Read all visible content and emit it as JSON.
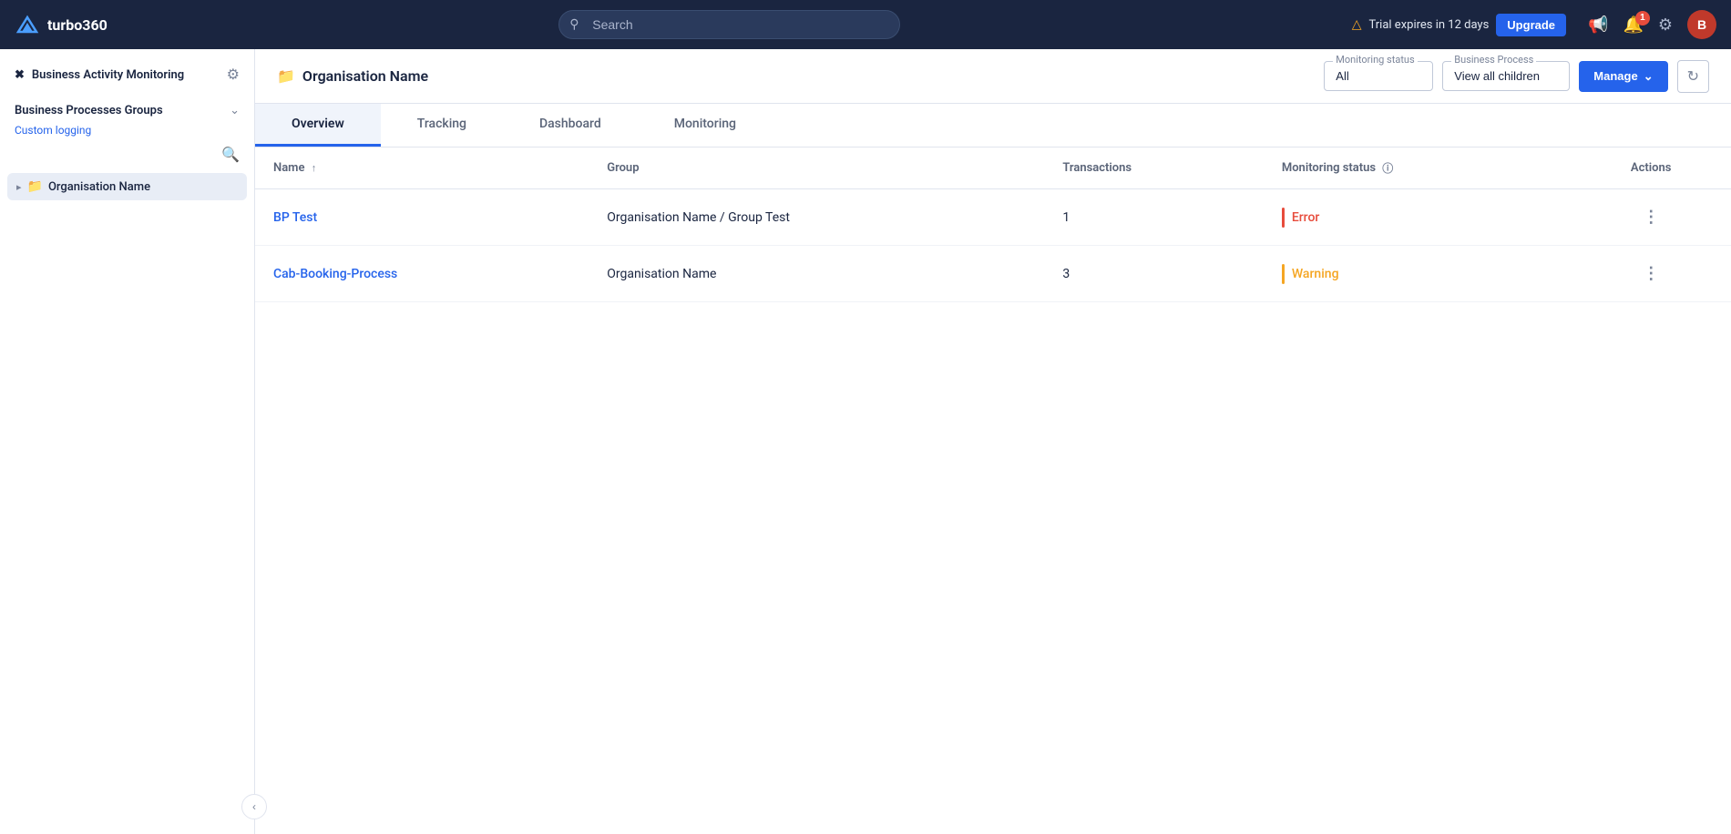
{
  "topnav": {
    "logo_text": "turbo360",
    "search_placeholder": "Search",
    "trial_text": "Trial expires in 12 days",
    "upgrade_label": "Upgrade",
    "notification_count": "1",
    "avatar_letter": "B"
  },
  "sidebar": {
    "title": "Business Activity Monitoring",
    "section_label": "Business Processes Groups",
    "section_sub": "Custom logging",
    "tree_item_label": "Organisation Name"
  },
  "content_header": {
    "breadcrumb": "Organisation Name",
    "monitoring_status_label": "Monitoring status",
    "monitoring_status_value": "All",
    "business_process_label": "Business Process",
    "business_process_value": "View all children",
    "manage_label": "Manage"
  },
  "tabs": [
    {
      "label": "Overview",
      "active": true
    },
    {
      "label": "Tracking",
      "active": false
    },
    {
      "label": "Dashboard",
      "active": false
    },
    {
      "label": "Monitoring",
      "active": false
    }
  ],
  "table": {
    "columns": [
      {
        "key": "name",
        "label": "Name",
        "sortable": true
      },
      {
        "key": "group",
        "label": "Group"
      },
      {
        "key": "transactions",
        "label": "Transactions"
      },
      {
        "key": "monitoring_status",
        "label": "Monitoring status",
        "info": true
      },
      {
        "key": "actions",
        "label": "Actions"
      }
    ],
    "rows": [
      {
        "name": "BP Test",
        "group": "Organisation Name / Group Test",
        "transactions": "1",
        "monitoring_status": "Error",
        "status_type": "error"
      },
      {
        "name": "Cab-Booking-Process",
        "group": "Organisation Name",
        "transactions": "3",
        "monitoring_status": "Warning",
        "status_type": "warning"
      }
    ]
  }
}
